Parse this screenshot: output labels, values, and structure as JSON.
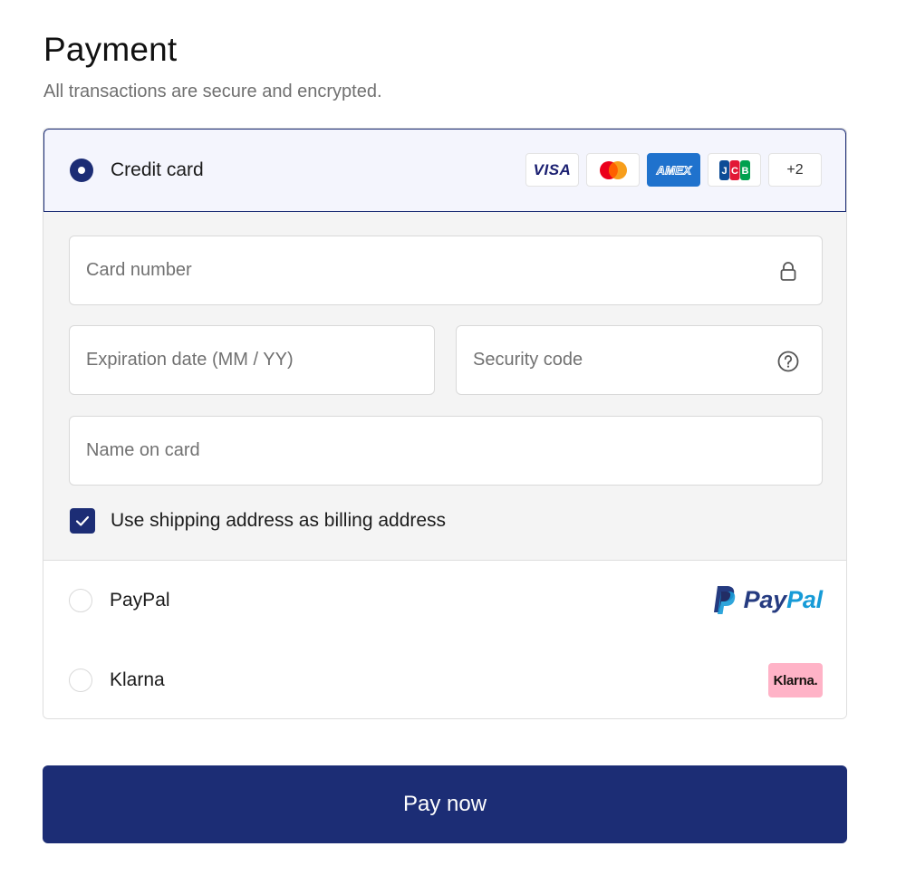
{
  "header": {
    "title": "Payment",
    "subtitle": "All transactions are secure and encrypted."
  },
  "payment_methods": {
    "credit_card": {
      "label": "Credit card",
      "selected": true,
      "brands": [
        {
          "name": "visa-icon",
          "text": "VISA"
        },
        {
          "name": "mastercard-icon"
        },
        {
          "name": "amex-icon",
          "text": "AMEX"
        },
        {
          "name": "jcb-icon",
          "text": "JCB"
        },
        {
          "name": "more-brands",
          "text": "+2"
        }
      ],
      "fields": {
        "card_number": {
          "placeholder": "Card number",
          "icon": "lock-icon"
        },
        "expiration": {
          "placeholder": "Expiration date (MM / YY)"
        },
        "security_code": {
          "placeholder": "Security code",
          "icon": "help-circle-icon"
        },
        "name_on_card": {
          "placeholder": "Name on card"
        }
      },
      "billing_checkbox": {
        "label": "Use shipping address as billing address",
        "checked": true
      }
    },
    "paypal": {
      "label": "PayPal",
      "selected": false,
      "logo_pay": "Pay",
      "logo_pal": "Pal"
    },
    "klarna": {
      "label": "Klarna",
      "selected": false,
      "badge_text": "Klarna."
    }
  },
  "actions": {
    "pay_label": "Pay now"
  },
  "colors": {
    "primary": "#1c2d75",
    "header_bg": "#f4f5fd",
    "form_bg": "#f4f4f4",
    "klarna_pink": "#ffb3c7",
    "paypal_dark": "#253b80",
    "paypal_light": "#179bd7"
  }
}
